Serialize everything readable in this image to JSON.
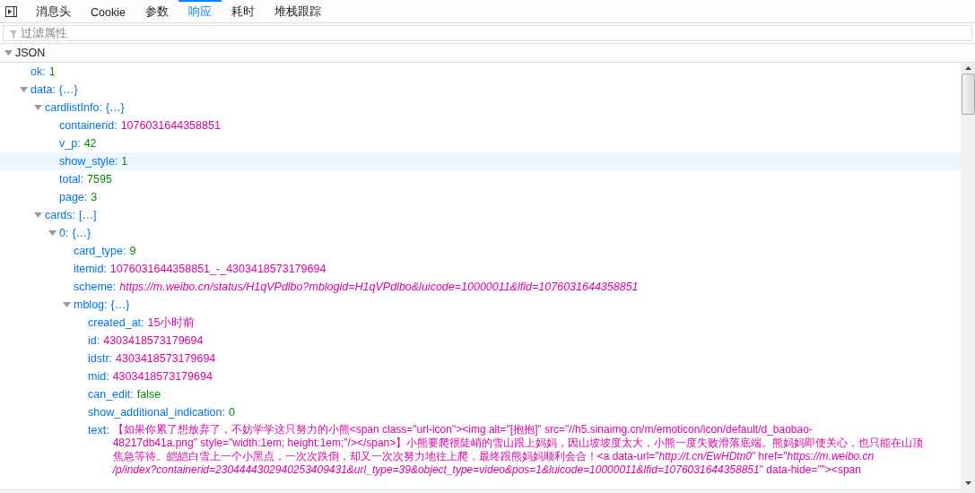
{
  "toolbar": {
    "tabs": [
      {
        "label": "消息头",
        "selected": false
      },
      {
        "label": "Cookie",
        "selected": false
      },
      {
        "label": "参数",
        "selected": false
      },
      {
        "label": "响应",
        "selected": true
      },
      {
        "label": "耗时",
        "selected": false
      },
      {
        "label": "堆栈跟踪",
        "selected": false
      }
    ]
  },
  "filter": {
    "placeholder": "过滤属性"
  },
  "section": {
    "label": "JSON",
    "expanded": true
  },
  "tree": [
    {
      "key": "ok:",
      "value": "1",
      "kind": "number",
      "highlighted": false
    },
    {
      "key": "data:",
      "value": "{…}",
      "kind": "object",
      "expanded": true,
      "highlighted": false,
      "children": [
        {
          "key": "cardlistInfo:",
          "value": "{…}",
          "kind": "object",
          "expanded": true,
          "highlighted": false,
          "children": [
            {
              "key": "containerid:",
              "value": "1076031644358851",
              "kind": "string",
              "highlighted": false
            },
            {
              "key": "v_p:",
              "value": "42",
              "kind": "number",
              "highlighted": false
            },
            {
              "key": "show_style:",
              "value": "1",
              "kind": "number",
              "highlighted": true
            },
            {
              "key": "total:",
              "value": "7595",
              "kind": "number",
              "highlighted": false
            },
            {
              "key": "page:",
              "value": "3",
              "kind": "number",
              "highlighted": false
            }
          ]
        },
        {
          "key": "cards:",
          "value": "[…]",
          "kind": "object",
          "expanded": true,
          "highlighted": false,
          "children": [
            {
              "key": "0:",
              "value": "{…}",
              "kind": "object",
              "expanded": true,
              "highlighted": false,
              "children": [
                {
                  "key": "card_type:",
                  "value": "9",
                  "kind": "number",
                  "highlighted": false
                },
                {
                  "key": "itemid:",
                  "value": "1076031644358851_-_4303418573179694",
                  "kind": "string",
                  "highlighted": false
                },
                {
                  "key": "scheme:",
                  "value": "https://m.weibo.cn/status/H1qVPdlbo?mblogid=H1qVPdlbo&luicode=10000011&lfid=1076031644358851",
                  "kind": "url",
                  "highlighted": false
                },
                {
                  "key": "mblog:",
                  "value": "{…}",
                  "kind": "object",
                  "expanded": true,
                  "highlighted": false,
                  "children": [
                    {
                      "key": "created_at:",
                      "value": "15小时前",
                      "kind": "string",
                      "highlighted": false
                    },
                    {
                      "key": "id:",
                      "value": "4303418573179694",
                      "kind": "string",
                      "highlighted": false
                    },
                    {
                      "key": "idstr:",
                      "value": "4303418573179694",
                      "kind": "string",
                      "highlighted": false
                    },
                    {
                      "key": "mid:",
                      "value": "4303418573179694",
                      "kind": "string",
                      "highlighted": false
                    },
                    {
                      "key": "can_edit:",
                      "value": "false",
                      "kind": "number",
                      "highlighted": false
                    },
                    {
                      "key": "show_additional_indication:",
                      "value": "0",
                      "kind": "number",
                      "highlighted": false
                    },
                    {
                      "key": "text:",
                      "kind": "multiline",
                      "highlighted": false,
                      "lines": [
                        "【如果你累了想放弃了，不妨学学这只努力的小熊<span class=\"url-icon\"><img alt=\"[抱抱]\" src=\"//h5.sinaimg.cn/m/emoticon/icon/default/d_baobao-",
                        "48217db41a.png\" style=\"width:1em; height:1em;\"/></span>】小熊要爬很陡峭的雪山跟上妈妈，因山坡坡度太大，小熊一度失败滑落底端。熊妈妈即使关心，也只能在山顶",
                        "焦急等待。皑皑白雪上一个小黑点，一次次跌倒，却又一次次努力地往上爬，最终跟熊妈妈顺利会合！<a data-url=\"*http://t.cn/EwHDtn0*\" href=\"*https://m.weibo.cn*",
                        "*/p/index?containerid=2304444302940253409431&url_type=39&object_type=video&pos=1&luicode=10000011&lfid=1076031644358851*\" data-hide=\"\"><span"
                      ]
                    }
                  ]
                }
              ]
            }
          ]
        }
      ]
    }
  ]
}
